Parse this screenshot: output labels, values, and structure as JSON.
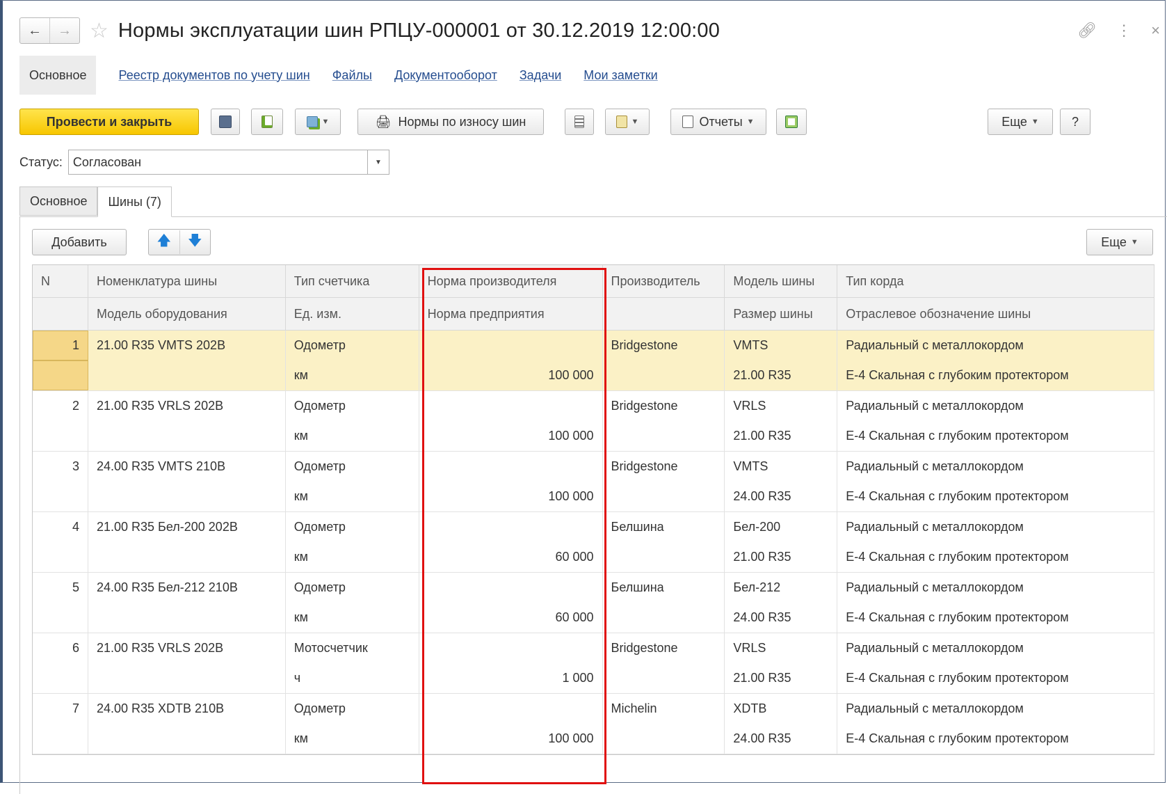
{
  "window": {
    "title": "Нормы эксплуатации шин РПЦУ-000001 от 30.12.2019 12:00:00",
    "back_icon": "arrow-left-icon",
    "forward_icon": "arrow-right-icon",
    "favorite_icon": "star-icon"
  },
  "formnav": {
    "active": "Основное",
    "links": [
      "Реестр документов по учету шин",
      "Файлы",
      "Документооборот",
      "Задачи",
      "Мои заметки"
    ]
  },
  "toolbar": {
    "post_close": "Провести и закрыть",
    "tire_norms": "Нормы по износу шин",
    "reports": "Отчеты",
    "more": "Еще",
    "help": "?"
  },
  "status": {
    "label": "Статус:",
    "value": "Согласован"
  },
  "tabs": [
    "Основное",
    "Шины (7)"
  ],
  "table_toolbar": {
    "add": "Добавить",
    "more": "Еще"
  },
  "table": {
    "header_row1": [
      "N",
      "Номенклатура шины",
      "Тип счетчика",
      "Норма производителя",
      "Производитель",
      "Модель шины",
      "Тип корда"
    ],
    "header_row2": [
      "",
      "Модель оборудования",
      "Ед. изм.",
      "Норма предприятия",
      "",
      "Размер шины",
      "Отраслевое обозначение шины"
    ],
    "rows": [
      {
        "n": "1",
        "nomenclature": "21.00 R35  VMTS  202B",
        "equipment": "",
        "counter": "Одометр",
        "unit": "км",
        "maker_norm": "",
        "company_norm": "100 000",
        "maker": "Bridgestone",
        "model": "VMTS",
        "size": "21.00 R35",
        "cord": "Радиальный с металлокордом",
        "designation": "E-4 Скальная с глубоким протектором"
      },
      {
        "n": "2",
        "nomenclature": "21.00 R35  VRLS  202B",
        "equipment": "",
        "counter": "Одометр",
        "unit": "км",
        "maker_norm": "",
        "company_norm": "100 000",
        "maker": "Bridgestone",
        "model": "VRLS",
        "size": "21.00 R35",
        "cord": "Радиальный с металлокордом",
        "designation": "E-4 Скальная с глубоким протектором"
      },
      {
        "n": "3",
        "nomenclature": "24.00 R35  VMTS  210B",
        "equipment": "",
        "counter": "Одометр",
        "unit": "км",
        "maker_norm": "",
        "company_norm": "100 000",
        "maker": "Bridgestone",
        "model": "VMTS",
        "size": "24.00 R35",
        "cord": "Радиальный с металлокордом",
        "designation": "E-4 Скальная с глубоким протектором"
      },
      {
        "n": "4",
        "nomenclature": "21.00 R35  Бел-200  202B",
        "equipment": "",
        "counter": "Одометр",
        "unit": "км",
        "maker_norm": "",
        "company_norm": "60 000",
        "maker": "Белшина",
        "model": "Бел-200",
        "size": "21.00 R35",
        "cord": "Радиальный с металлокордом",
        "designation": "E-4 Скальная с глубоким протектором"
      },
      {
        "n": "5",
        "nomenclature": "24.00 R35  Бел-212  210B",
        "equipment": "",
        "counter": "Одометр",
        "unit": "км",
        "maker_norm": "",
        "company_norm": "60 000",
        "maker": "Белшина",
        "model": "Бел-212",
        "size": "24.00 R35",
        "cord": "Радиальный с металлокордом",
        "designation": "E-4 Скальная с глубоким протектором"
      },
      {
        "n": "6",
        "nomenclature": "21.00 R35  VRLS  202B",
        "equipment": "",
        "counter": "Мотосчетчик",
        "unit": "ч",
        "maker_norm": "",
        "company_norm": "1 000",
        "maker": "Bridgestone",
        "model": "VRLS",
        "size": "21.00 R35",
        "cord": "Радиальный с металлокордом",
        "designation": "E-4 Скальная с глубоким протектором"
      },
      {
        "n": "7",
        "nomenclature": "24.00 R35  XDTB  210B",
        "equipment": "",
        "counter": "Одометр",
        "unit": "км",
        "maker_norm": "",
        "company_norm": "100 000",
        "maker": "Michelin",
        "model": "XDTB",
        "size": "24.00 R35",
        "cord": "Радиальный с металлокордом",
        "designation": "E-4 Скальная с глубоким протектором"
      }
    ]
  },
  "colors": {
    "accent_yellow": "#f7c600",
    "link": "#254d8f",
    "selected_row": "#fbf1c6",
    "highlight_box": "#e01010"
  }
}
